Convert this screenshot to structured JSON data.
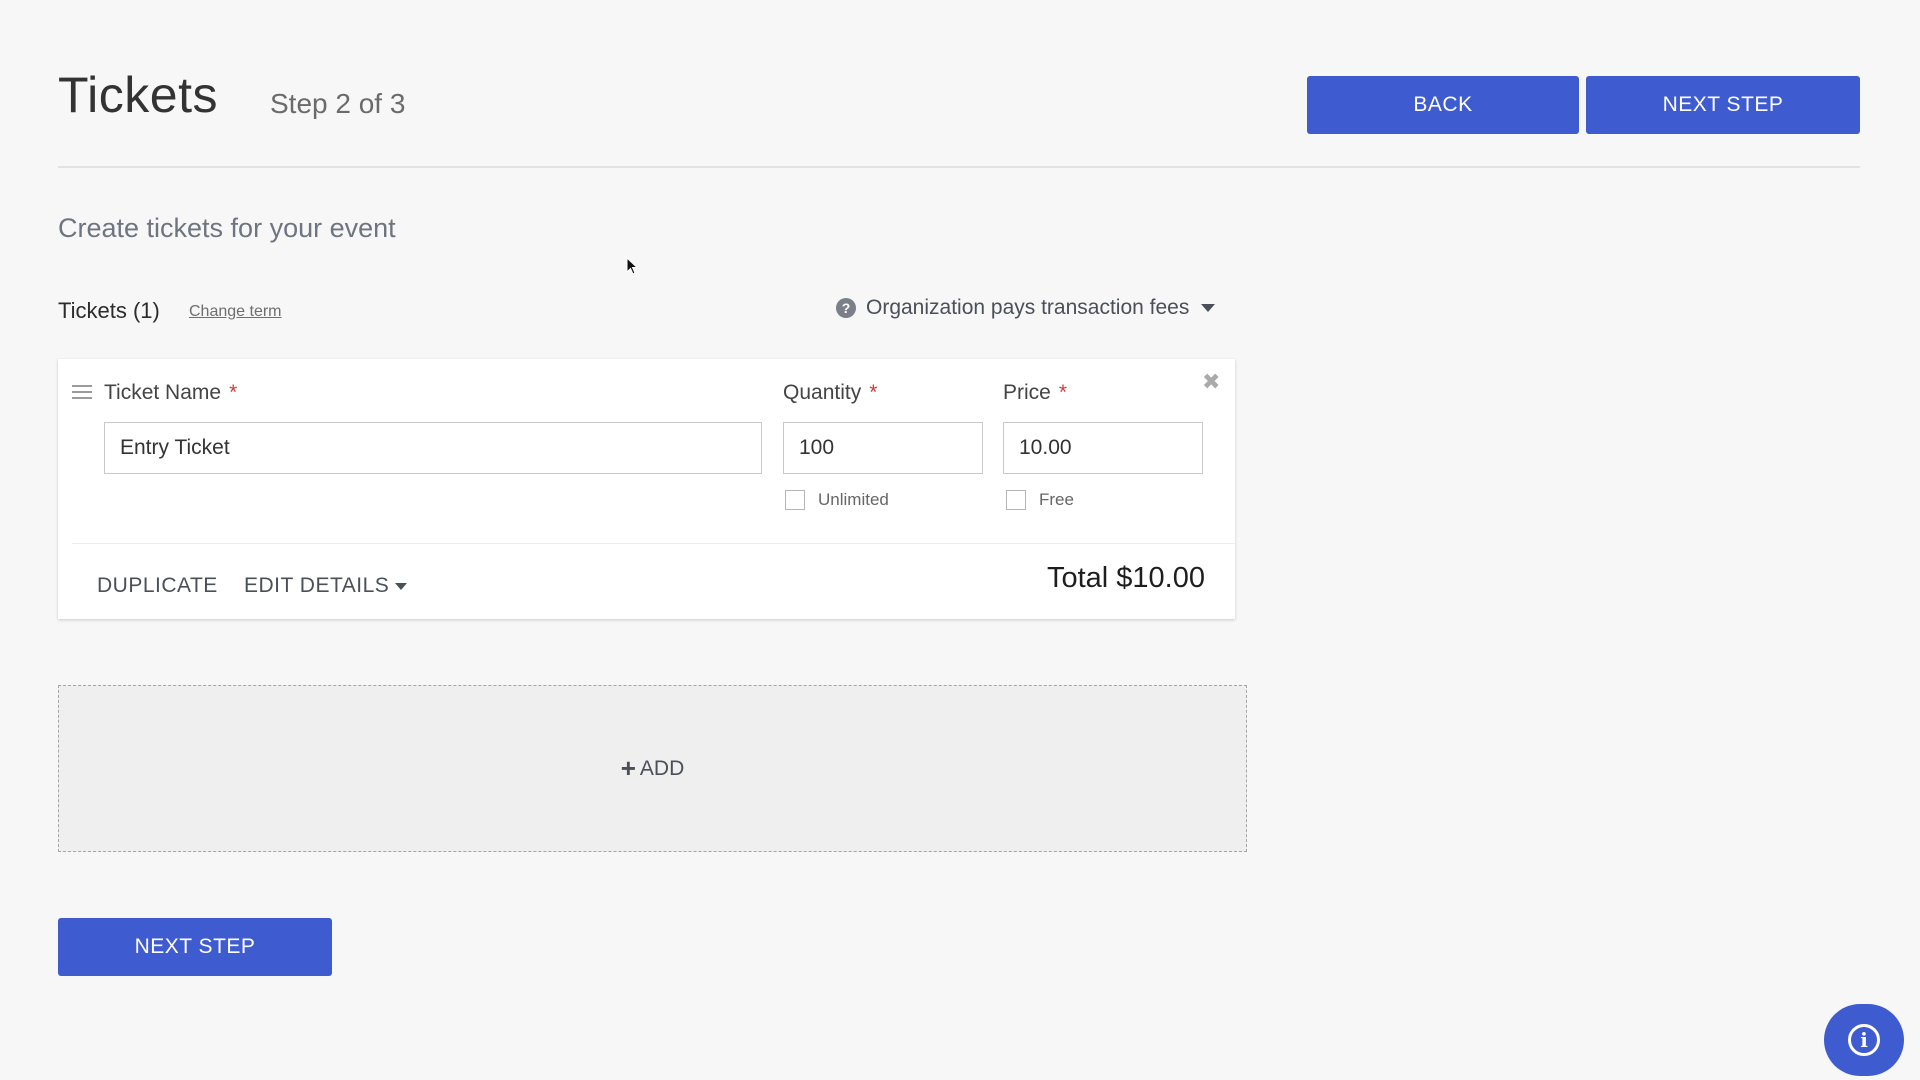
{
  "header": {
    "title": "Tickets",
    "step": "Step 2 of 3",
    "back_label": "BACK",
    "next_label": "NEXT STEP"
  },
  "subtitle": "Create tickets for your event",
  "tickets_section": {
    "heading": "Tickets (1)",
    "change_term_label": "Change term",
    "fee_option": "Organization pays transaction fees"
  },
  "ticket": {
    "name_label": "Ticket Name",
    "name_value": "Entry Ticket",
    "quantity_label": "Quantity",
    "quantity_value": "100",
    "unlimited_label": "Unlimited",
    "price_label": "Price",
    "price_value": "10.00",
    "free_label": "Free",
    "duplicate_label": "DUPLICATE",
    "edit_details_label": "EDIT DETAILS",
    "total": "Total $10.00",
    "required_mark": "*"
  },
  "add_label": "ADD",
  "footer": {
    "next_label": "NEXT STEP"
  },
  "colors": {
    "primary": "#3f5bd0",
    "required": "#d33a3a"
  },
  "icons": [
    "drag-handle-icon",
    "help-icon",
    "chevron-down-icon",
    "close-icon",
    "plus-icon",
    "info-icon"
  ]
}
